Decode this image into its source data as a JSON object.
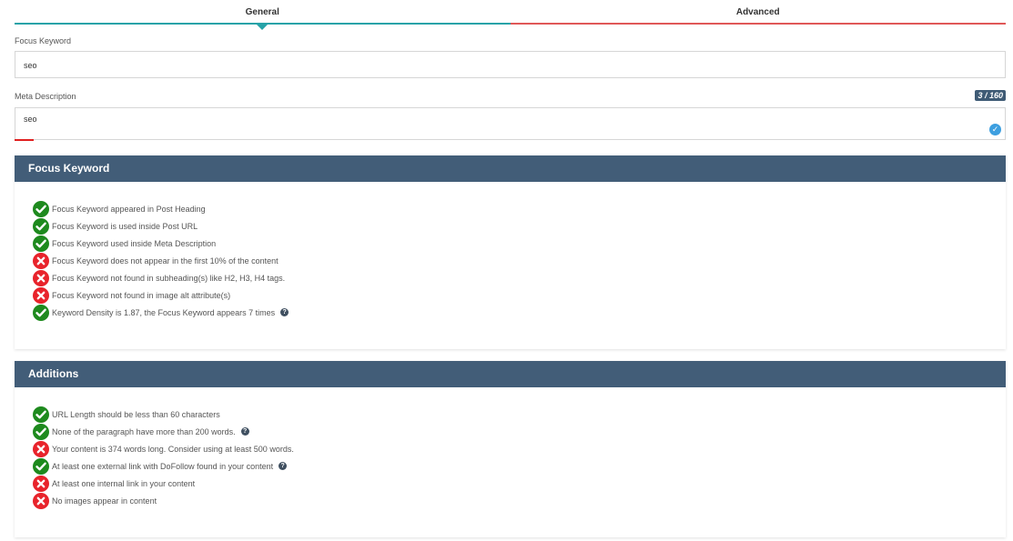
{
  "tabs": [
    {
      "label": "General"
    },
    {
      "label": "Advanced"
    }
  ],
  "focus_keyword": {
    "label": "Focus Keyword",
    "value": "seo"
  },
  "meta_description": {
    "label": "Meta Description",
    "value": "seo",
    "counter": "3 / 160"
  },
  "focus_section": {
    "title": "Focus Keyword",
    "items": [
      {
        "status": "ok",
        "text": "Focus Keyword appeared in Post Heading",
        "help": false
      },
      {
        "status": "ok",
        "text": "Focus Keyword is used inside Post URL",
        "help": false
      },
      {
        "status": "ok",
        "text": "Focus Keyword used inside Meta Description",
        "help": false
      },
      {
        "status": "bad",
        "text": "Focus Keyword does not appear in the first 10% of the content",
        "help": false
      },
      {
        "status": "bad",
        "text": "Focus Keyword not found in subheading(s) like H2, H3, H4 tags.",
        "help": false
      },
      {
        "status": "bad",
        "text": "Focus Keyword not found in image alt attribute(s)",
        "help": false
      },
      {
        "status": "ok",
        "text": "Keyword Density is 1.87, the Focus Keyword appears 7 times",
        "help": true
      }
    ]
  },
  "additions_section": {
    "title": "Additions",
    "items": [
      {
        "status": "ok",
        "text": "URL Length should be less than 60 characters",
        "help": false
      },
      {
        "status": "ok",
        "text": "None of the paragraph have more than 200 words.",
        "help": true
      },
      {
        "status": "bad",
        "text": "Your content is 374 words long. Consider using at least 500 words.",
        "help": false
      },
      {
        "status": "ok",
        "text": "At least one external link with DoFollow found in your content",
        "help": true
      },
      {
        "status": "bad",
        "text": "At least one internal link in your content",
        "help": false
      },
      {
        "status": "bad",
        "text": "No images appear in content",
        "help": false
      }
    ]
  },
  "colors": {
    "ok": "#1e8a1e",
    "bad": "#e8232b",
    "header": "#425d78",
    "tab_general": "#26a3a8",
    "tab_advanced": "#e05858"
  }
}
